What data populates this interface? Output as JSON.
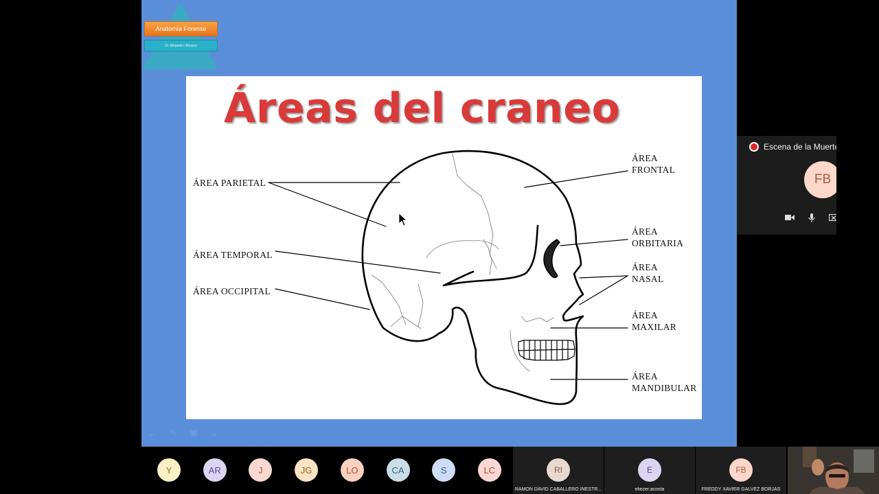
{
  "slide": {
    "course_title": "Anatomía Forense",
    "teacher": "Dr. Alejandro Álvarez",
    "title": "Áreas del craneo",
    "labels": {
      "parietal": "ÁREA PARIETAL",
      "temporal": "ÁREA TEMPORAL",
      "occipital": "ÁREA OCCIPITAL",
      "frontal_1": "ÁREA",
      "frontal_2": "FRONTAL",
      "orbitaria_1": "ÁREA",
      "orbitaria_2": "ORBITARIA",
      "nasal_1": "ÁREA",
      "nasal_2": "NASAL",
      "maxilar_1": "ÁREA",
      "maxilar_2": "MAXILAR",
      "mandibular_1": "ÁREA",
      "mandibular_2": "MANDIBULAR"
    }
  },
  "meeting": {
    "recording_label": "Escena de la Muerte",
    "panel_initials": "FB",
    "participants": [
      {
        "initials": "Y",
        "bg": "#fbf0c5",
        "fg": "#8a6d1d"
      },
      {
        "initials": "AR",
        "bg": "#dcd5f2",
        "fg": "#5a4a92"
      },
      {
        "initials": "J",
        "bg": "#fbd8d2",
        "fg": "#b0503e"
      },
      {
        "initials": "JG",
        "bg": "#fbe4c5",
        "fg": "#9a6520"
      },
      {
        "initials": "LO",
        "bg": "#fbd0c0",
        "fg": "#b04a2a"
      },
      {
        "initials": "CA",
        "bg": "#c9dde8",
        "fg": "#3d6275"
      },
      {
        "initials": "S",
        "bg": "#cfdcf5",
        "fg": "#3a5a9a"
      },
      {
        "initials": "LC",
        "bg": "#fbd8d2",
        "fg": "#b04a3a"
      }
    ],
    "tiles": [
      {
        "initials": "RI",
        "name": "RAMON DAVID CABALLERO INESTR...",
        "bg": "#e8d8d0",
        "fg": "#7a5a4a"
      },
      {
        "initials": "E",
        "name": "eliezer.acosta",
        "bg": "#dcd5f2",
        "fg": "#4a3a8a"
      },
      {
        "initials": "FB",
        "name": "FREDDY XAVIER GALVEZ BORJAS",
        "bg": "#fbd8c9",
        "fg": "#a85e4a"
      }
    ]
  }
}
